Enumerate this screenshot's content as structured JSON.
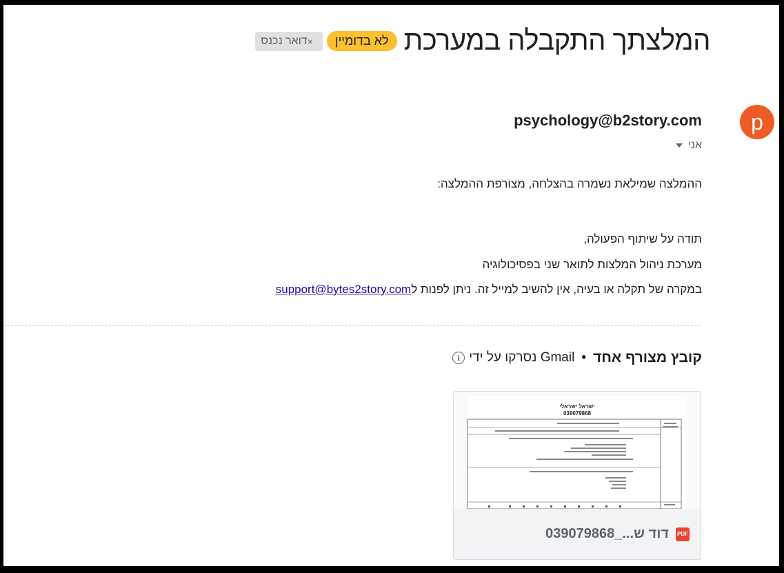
{
  "email": {
    "subject": "המלצתך התקבלה במערכת",
    "labels": {
      "important": "לא בדומיין",
      "inbox": "דואר נכנס",
      "remove_glyph": "×"
    },
    "sender": {
      "avatar_letter": "p",
      "address": "psychology@b2story.com",
      "to": "אני"
    },
    "body": {
      "line1": "ההמלצה שמילאת נשמרה בהצלחה, מצורפת ההמלצה:",
      "line2": "תודה על שיתוף הפעולה,",
      "line3": "מערכת ניהול המלצות לתואר שני בפסיכולוגיה",
      "line4_prefix": "במקרה של תקלה או בעיה, אין להשיב למייל זה. ניתן לפנות ל",
      "support_link": "support@bytes2story.com"
    },
    "attachments": {
      "count_label": "קובץ מצורף אחד",
      "scan_note": "נסרקו על ידי Gmail",
      "separator": "•",
      "file": {
        "name": "דוד ש..._039079868",
        "type_label": "PDF",
        "preview_title": "ישראל ישראלי",
        "preview_id": "039079868"
      }
    }
  },
  "colors": {
    "avatar": "#ef5b24",
    "important_chip": "#fbc02d",
    "pdf": "#ea4335"
  }
}
